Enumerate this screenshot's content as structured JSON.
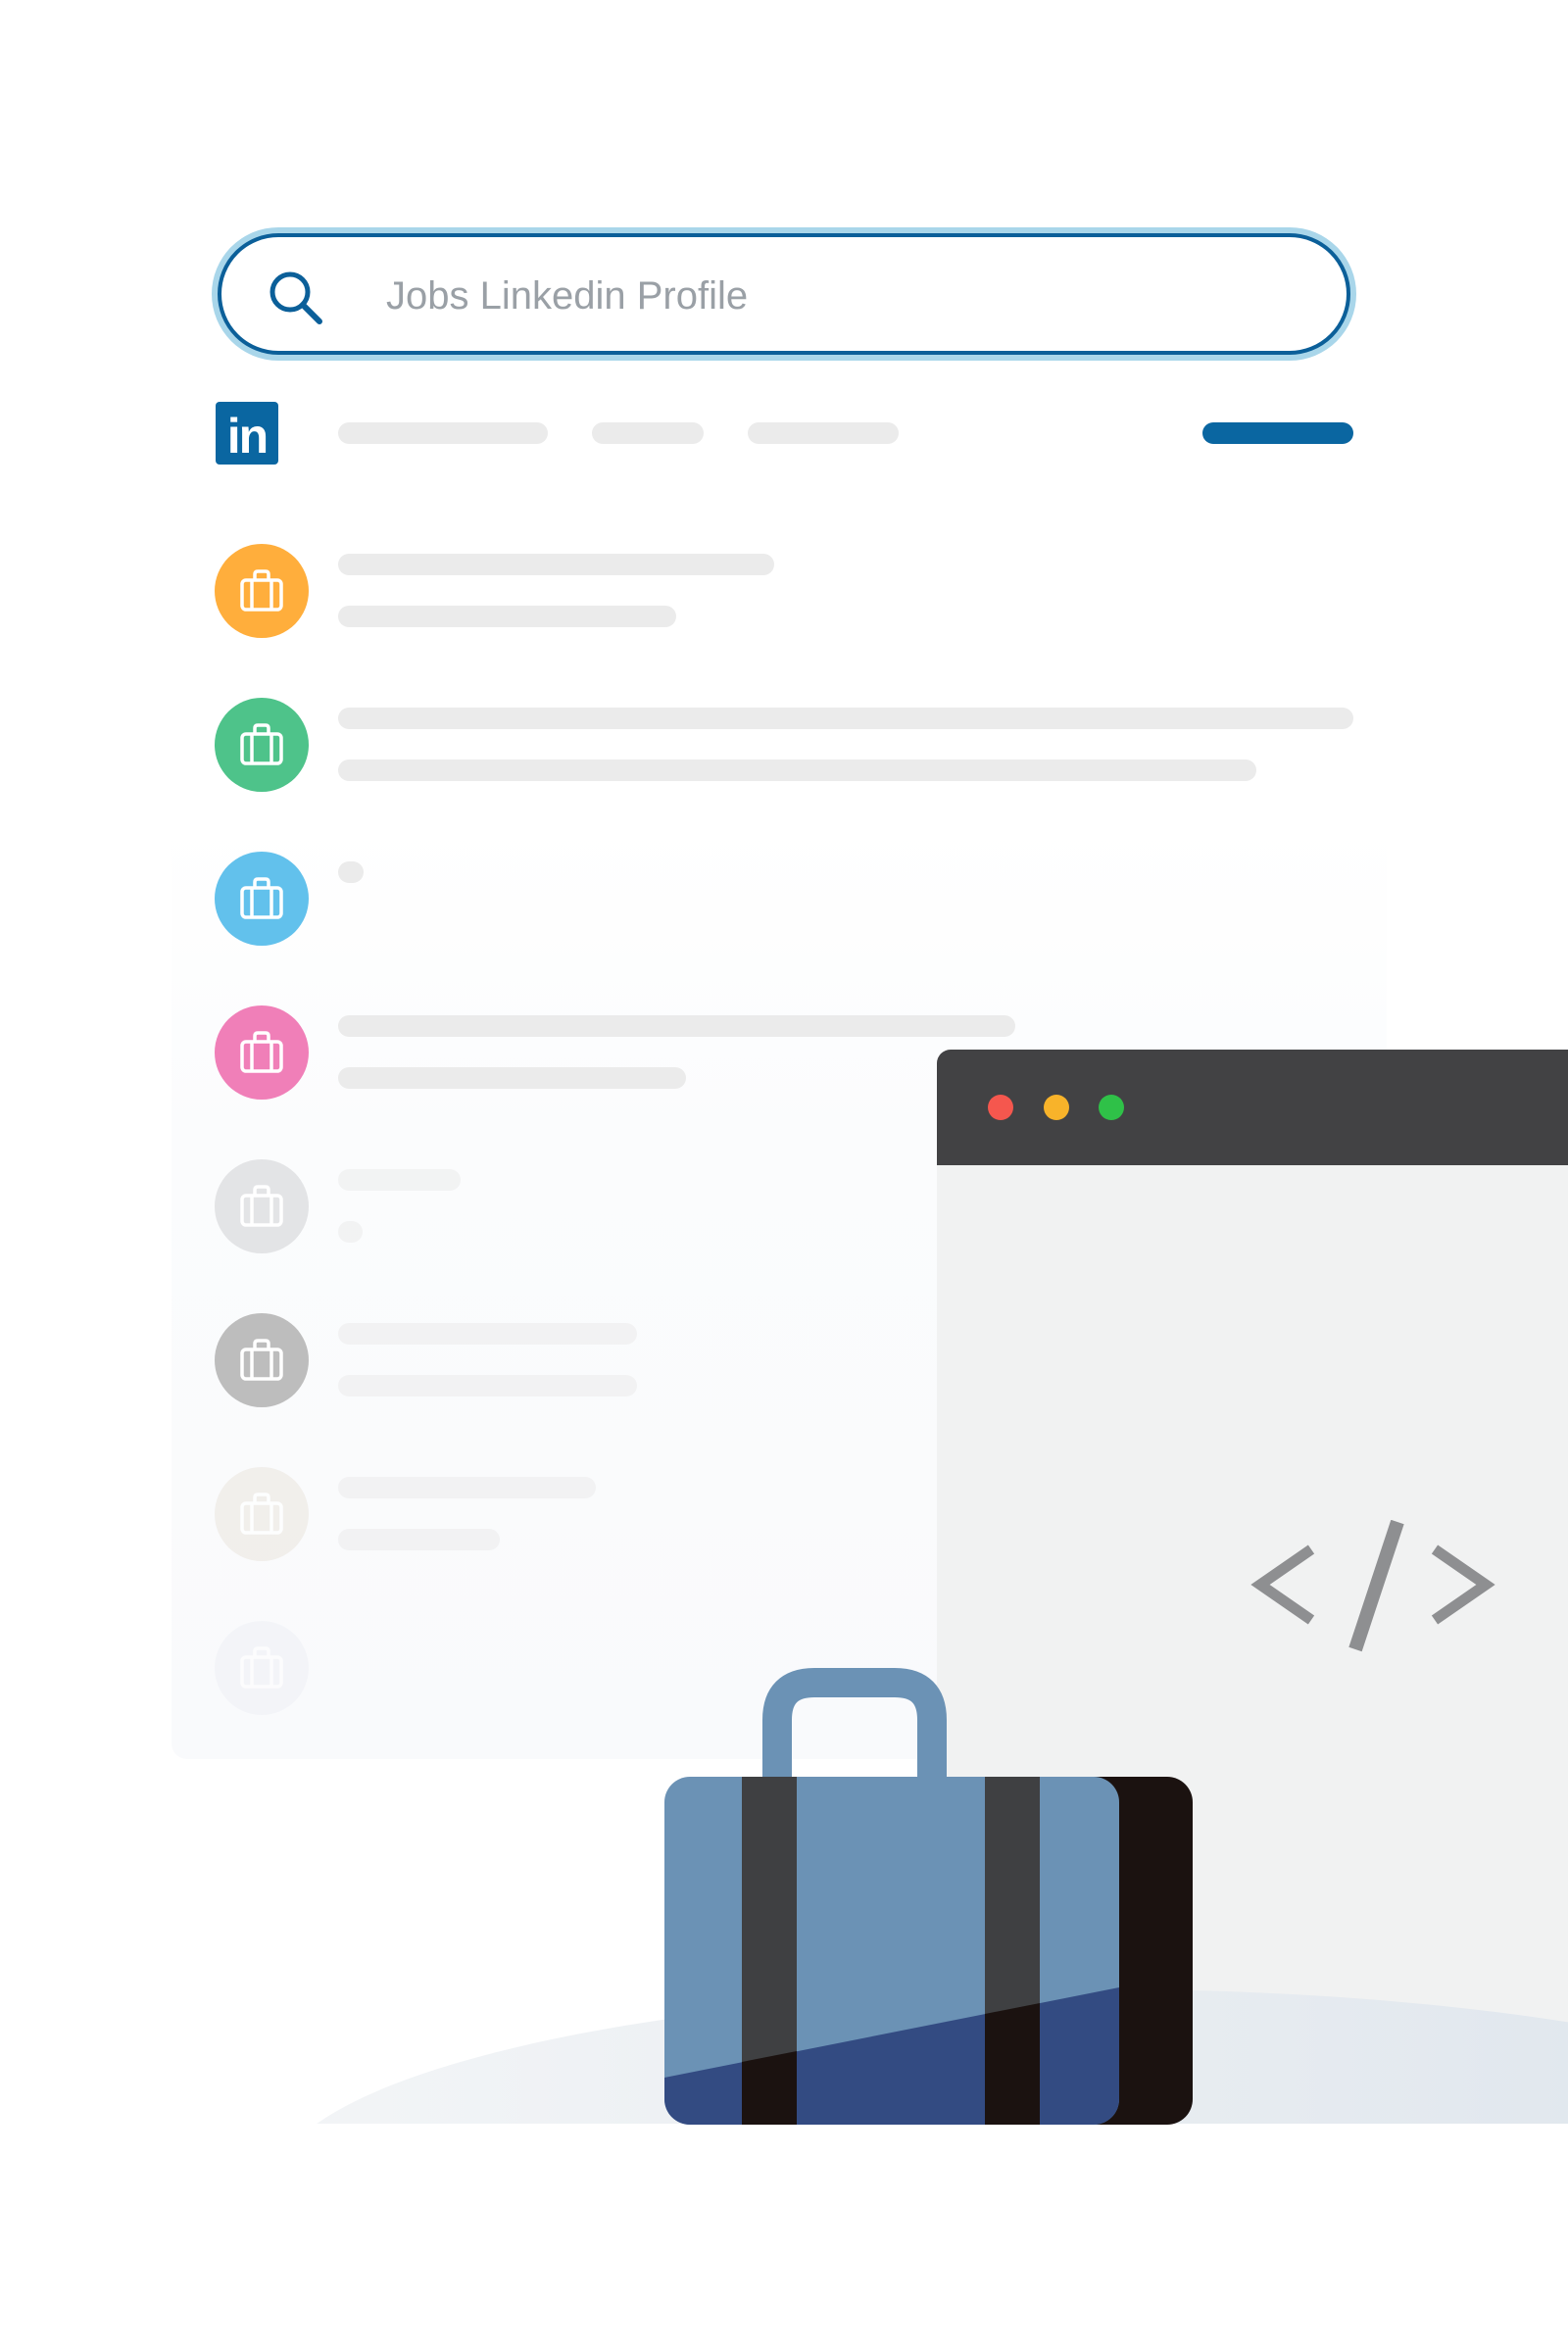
{
  "search": {
    "placeholder": "Jobs Linkedin Profile"
  },
  "logo": {
    "text": "in",
    "color": "#0a66a1"
  },
  "job_icon_colors": [
    "#ffae3c",
    "#4ec38a",
    "#62c1ec",
    "#f07fb8",
    "#e3e4e6",
    "#bdbdbd",
    "#efebe6",
    "#eef0f6"
  ],
  "browser": {
    "title_bar_color": "#424244",
    "dots": [
      "#f5574e",
      "#f8b32a",
      "#2fc148"
    ],
    "icon": "code-brackets-icon"
  },
  "suitcase": {
    "icon": "suitcase-icon",
    "body_color": "#6b92b5",
    "strap_color": "#3f4042",
    "handle_color": "#6b92b5"
  }
}
